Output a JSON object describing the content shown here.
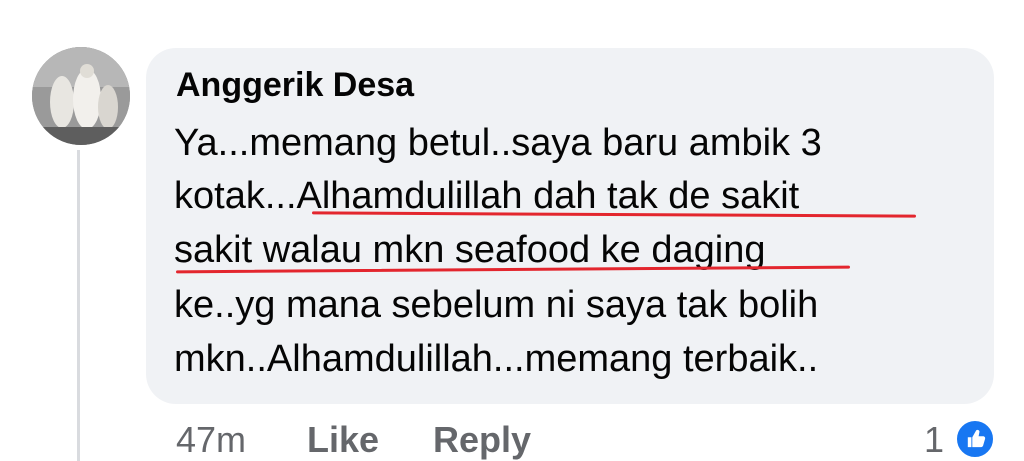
{
  "comment": {
    "author": "Anggerik Desa",
    "lines": [
      "Ya...memang betul..saya baru ambik 3",
      "kotak...Alhamdulillah dah tak de sakit",
      "sakit walau mkn seafood ke daging",
      "ke..yg mana sebelum ni saya tak bolih",
      "mkn..Alhamdulillah...memang terbaik.."
    ],
    "timestamp": "47m",
    "like_label": "Like",
    "reply_label": "Reply",
    "reaction_count": "1",
    "reaction_icon": "thumbs-up-icon",
    "highlight_color": "#e3262e",
    "accent_color": "#1877f2"
  }
}
